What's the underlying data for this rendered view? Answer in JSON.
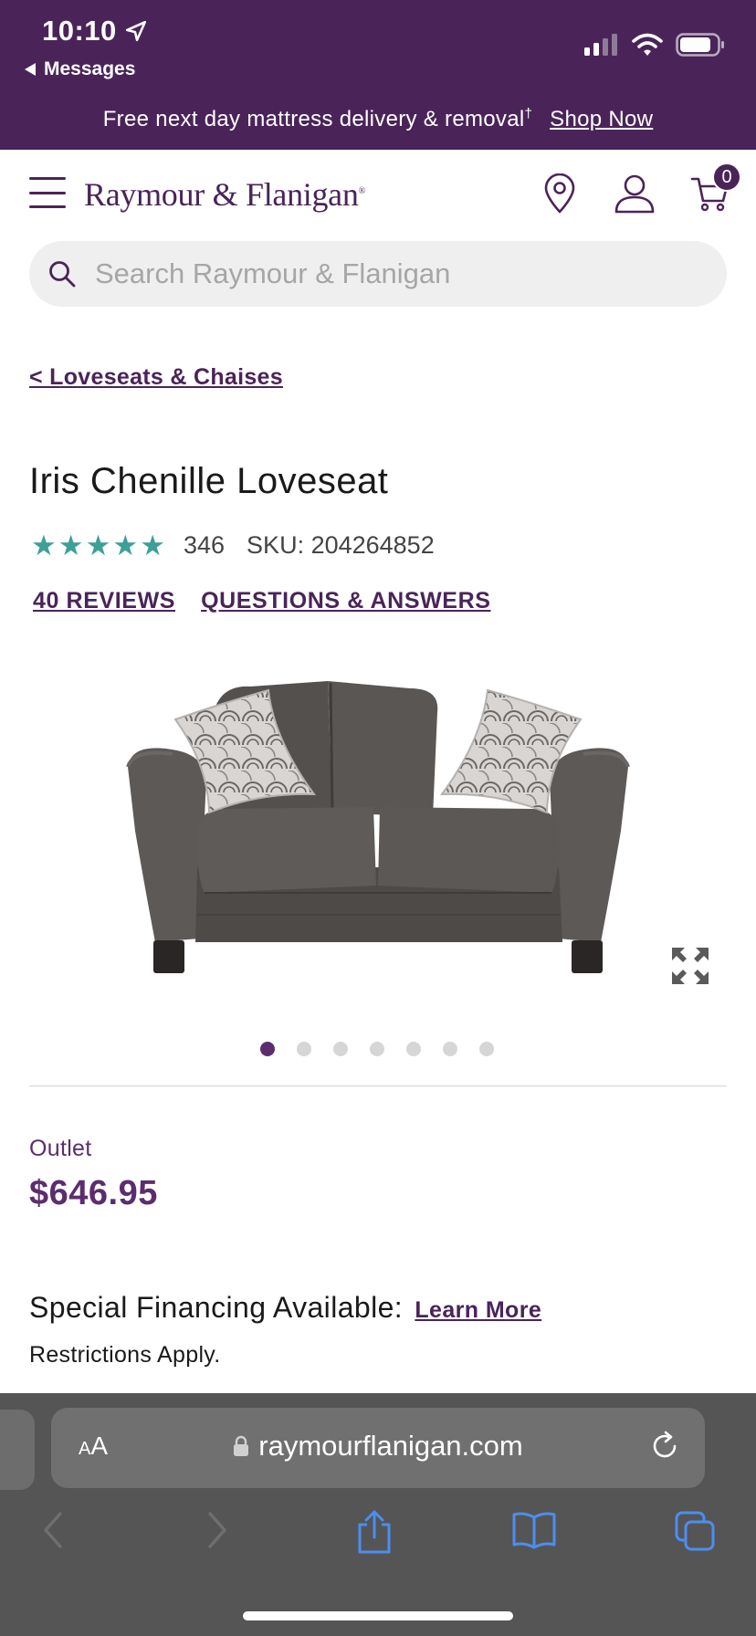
{
  "status_bar": {
    "time": "10:10",
    "back_label": "Messages"
  },
  "promo": {
    "text": "Free next day mattress delivery & removal",
    "marker": "†",
    "link": "Shop Now"
  },
  "header": {
    "logo": "Raymour & Flanigan",
    "logo_mark": "®",
    "cart_count": "0"
  },
  "search": {
    "placeholder": "Search Raymour & Flanigan"
  },
  "breadcrumb": "< Loveseats & Chaises",
  "product": {
    "title": "Iris Chenille Loveseat",
    "rating_stars": 5,
    "rating_count": "346",
    "sku": "SKU: 204264852",
    "reviews_link": "40 REVIEWS",
    "qa_link": "QUESTIONS & ANSWERS",
    "image_alt": "gray chenille loveseat with patterned pillows",
    "image_count": 7,
    "active_image_index": 0,
    "price_label": "Outlet",
    "price": "$646.95",
    "financing_text": "Special Financing Available:",
    "financing_link": "Learn More",
    "restrictions": "Restrictions Apply."
  },
  "browser": {
    "text_size_label": "AA",
    "url": "raymourflanigan.com"
  },
  "colors": {
    "brand": "#4a2459",
    "accent_price": "#5b2d6e",
    "star": "#3d9f97"
  }
}
